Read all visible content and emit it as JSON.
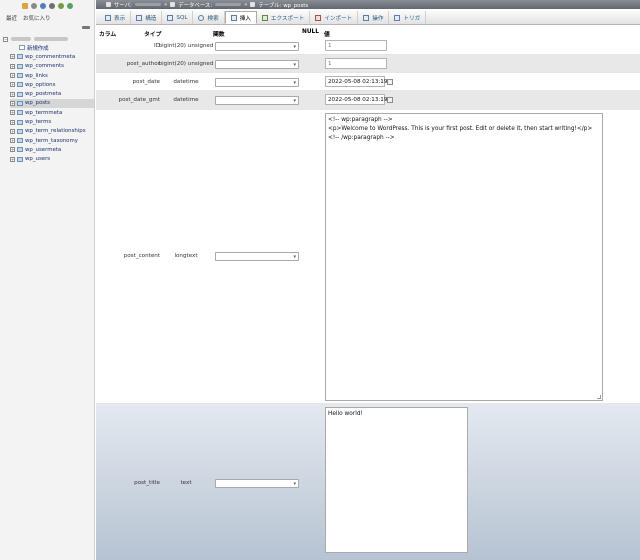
{
  "nav": {
    "tabs": [
      "最近",
      "お気に入り"
    ],
    "new_label": "新規作成",
    "tables": [
      {
        "name": "wp_commentmeta",
        "active": false
      },
      {
        "name": "wp_comments",
        "active": false
      },
      {
        "name": "wp_links",
        "active": false
      },
      {
        "name": "wp_options",
        "active": false
      },
      {
        "name": "wp_postmeta",
        "active": false
      },
      {
        "name": "wp_posts",
        "active": true
      },
      {
        "name": "wp_termmeta",
        "active": false
      },
      {
        "name": "wp_terms",
        "active": false
      },
      {
        "name": "wp_term_relationships",
        "active": false
      },
      {
        "name": "wp_term_taxonomy",
        "active": false
      },
      {
        "name": "wp_usermeta",
        "active": false
      },
      {
        "name": "wp_users",
        "active": false
      }
    ]
  },
  "breadcrumb": {
    "server": "サーバ:",
    "database": "データベース:",
    "table": "テーブル: wp_posts"
  },
  "tabs": [
    {
      "label": "表示",
      "icon": "browse-icon",
      "active": false
    },
    {
      "label": "構造",
      "icon": "structure-icon",
      "active": false
    },
    {
      "label": "SQL",
      "icon": "sql-icon",
      "active": false
    },
    {
      "label": "検索",
      "icon": "search-icon",
      "active": false
    },
    {
      "label": "挿入",
      "icon": "insert-icon",
      "active": true
    },
    {
      "label": "エクスポート",
      "icon": "export-icon",
      "active": false
    },
    {
      "label": "インポート",
      "icon": "import-icon",
      "active": false
    },
    {
      "label": "操作",
      "icon": "operations-icon",
      "active": false
    },
    {
      "label": "トリガ",
      "icon": "triggers-icon",
      "active": false
    }
  ],
  "form": {
    "headers": {
      "column": "カラム",
      "type": "タイプ",
      "function": "関数",
      "null": "NULL",
      "value": "値"
    },
    "rows": {
      "id": {
        "name": "ID",
        "type": "bigint(20) unsigned",
        "value": "1"
      },
      "post_author": {
        "name": "post_author",
        "type": "bigint(20) unsigned",
        "value": "1"
      },
      "post_date": {
        "name": "post_date",
        "type": "datetime",
        "value": "2022-05-08 02:13:19"
      },
      "post_date_gmt": {
        "name": "post_date_gmt",
        "type": "datetime",
        "value": "2022-05-08 02:13:19"
      },
      "post_content": {
        "name": "post_content",
        "type": "longtext",
        "value": "<!-- wp:paragraph -->\n<p>Welcome to WordPress. This is your first post. Edit or delete it, then start writing!</p>\n<!-- /wp:paragraph -->"
      },
      "post_title": {
        "name": "post_title",
        "type": "text",
        "value": "Hello world!"
      }
    }
  }
}
